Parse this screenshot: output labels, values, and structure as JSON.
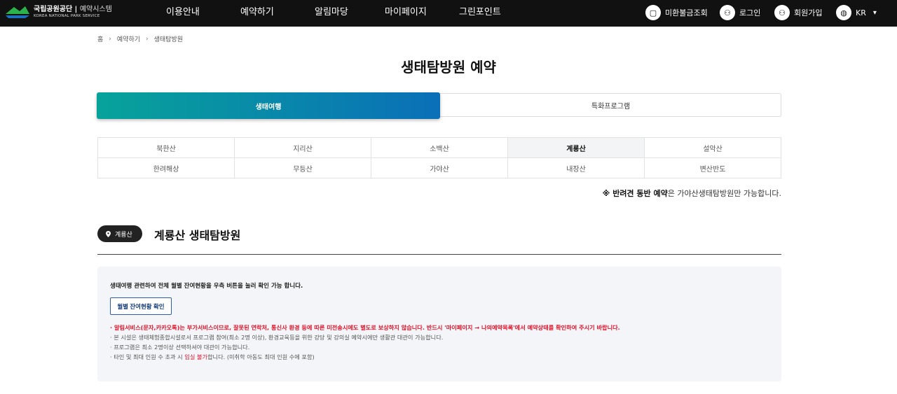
{
  "header": {
    "logo": {
      "name": "국립공원공단",
      "sub": "예약시스템",
      "eng": "KOREA NATIONAL PARK SERVICE"
    },
    "nav": [
      "이용안내",
      "예약하기",
      "알림마당",
      "마이페이지",
      "그린포인트"
    ],
    "util": {
      "refund": "미환불금조회",
      "login": "로그인",
      "signup": "회원가입",
      "lang": "KR"
    }
  },
  "breadcrumb": [
    "홈",
    "예약하기",
    "생태탐방원"
  ],
  "page_title": "생태탐방원 예약",
  "tabs": {
    "active": "생태여행",
    "inactive": "특화프로그램"
  },
  "parks": [
    [
      "북한산",
      "지리산",
      "소백산",
      "계룡산",
      "설악산"
    ],
    [
      "한려해상",
      "무등산",
      "가야산",
      "내장산",
      "변산반도"
    ]
  ],
  "pet_notice": {
    "prefix": "※ 반려견 동반 예약",
    "suffix": "은 가야산생태탐방원만 가능합니다."
  },
  "section": {
    "badge": "계룡산",
    "title": "계룡산 생태탐방원"
  },
  "info": {
    "intro": "생태여행 관련하여 전체 월별 잔여현황을 우측 버튼을 눌러 확인 가능 합니다.",
    "month_button": "월별 잔여현황 확인",
    "notes": [
      "· 알림서비스(문자,카카오톡)는 부가서비스이므로, 잘못된 연락처, 통신사 환경 등에 따른 미전송시에도 별도로 보상하지 않습니다. 반드시 '마이페이지 → 나의예약목록'에서 예약상태를 확인하여 주시기 바랍니다.",
      "· 본 시설은 생태체험종합시설로서 프로그램 참여(최소 2명 이상), 환경교육등을 위한 강당 및 강의실 예약시에만 생활관 대관이 가능합니다.",
      "· 프로그램은 최소 2명이상 선택하셔야 대관이 가능합니다."
    ],
    "note_last": {
      "pre": "· 타인 및 최대 인원 수 초과 시 ",
      "hl": "입실 불가",
      "post": "합니다. (미취학 아동도 최대 인원 수에 포함)"
    }
  }
}
